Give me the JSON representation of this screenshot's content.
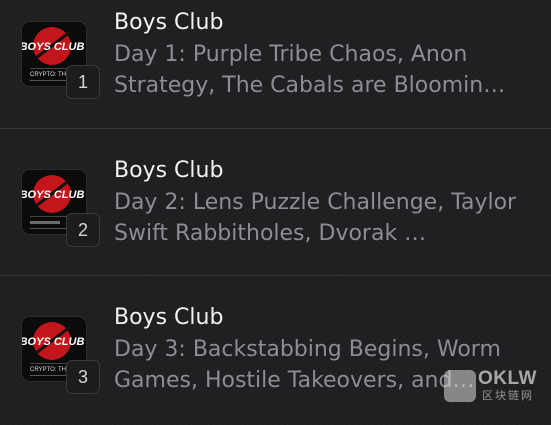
{
  "episodes": [
    {
      "index": "1",
      "show": "Boys Club",
      "title": "Day 1: Purple Tribe Chaos, Anon Strategy, The Cabals are Bloomin…",
      "thumbnail": {
        "logo": "BOYS CLUB",
        "caption": "CRYPTO: THE G"
      }
    },
    {
      "index": "2",
      "show": "Boys Club",
      "title": "Day 2: Lens Puzzle Challenge, Taylor Swift Rabbitholes, Dvorak …",
      "thumbnail": {
        "logo": "BOYS CLUB",
        "caption": ""
      }
    },
    {
      "index": "3",
      "show": "Boys Club",
      "title": "Day 3: Backstabbing Begins, Worm Games, Hostile Takeovers, and…",
      "thumbnail": {
        "logo": "BOYS CLUB",
        "caption": "CRYPTO: THE G"
      }
    }
  ],
  "watermark": {
    "text": "OKLW",
    "subtext": "区块链网"
  },
  "colors": {
    "background": "#1f1f21",
    "title": "#f2f2f2",
    "subtitle": "#8d8d92",
    "accent_red": "#d8262c"
  }
}
